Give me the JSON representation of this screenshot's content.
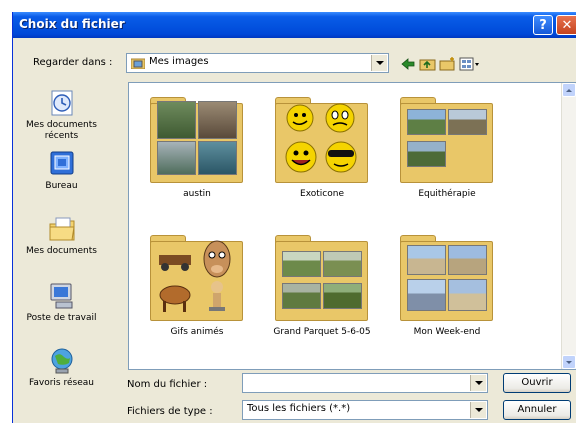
{
  "window": {
    "title": "Choix du fichier",
    "help_glyph": "?",
    "close_glyph": "✕"
  },
  "toolbar": {
    "look_in_label": "Regarder dans :",
    "look_in_value": "Mes images",
    "tools": [
      "back-arrow-icon",
      "up-folder-icon",
      "new-folder-icon",
      "view-menu-icon"
    ]
  },
  "places": [
    {
      "label": "Mes documents récents",
      "icon": "recent-documents-icon"
    },
    {
      "label": "Bureau",
      "icon": "desktop-icon"
    },
    {
      "label": "Mes documents",
      "icon": "my-documents-icon"
    },
    {
      "label": "Poste de travail",
      "icon": "my-computer-icon"
    },
    {
      "label": "Favoris réseau",
      "icon": "network-places-icon"
    }
  ],
  "folders": [
    {
      "label": "austin"
    },
    {
      "label": "Exoticone"
    },
    {
      "label": "Equithérapie"
    },
    {
      "label": "Gifs animés"
    },
    {
      "label": "Grand Parquet 5-6-05"
    },
    {
      "label": "Mon Week-end"
    }
  ],
  "filename": {
    "label": "Nom du fichier :",
    "value": ""
  },
  "filetype": {
    "label": "Fichiers de type :",
    "value": "Tous les fichiers (*.*)"
  },
  "buttons": {
    "open": "Ouvrir",
    "cancel": "Annuler"
  },
  "colors": {
    "title_bar": "#0454E0",
    "window_bg": "#ECE9D8",
    "folder": "#E9C768",
    "close_button": "#D5552F"
  }
}
